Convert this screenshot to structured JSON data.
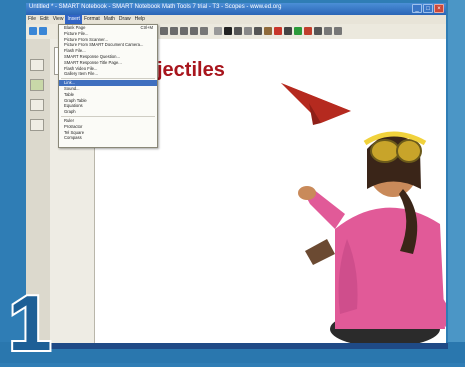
{
  "window": {
    "title": "Untitled * - SMART Notebook - SMART Notebook Math Tools 7 trial - T3 - Scopes - www.ed.org"
  },
  "menubar": [
    {
      "label": "File"
    },
    {
      "label": "Edit"
    },
    {
      "label": "View"
    },
    {
      "label": "Insert",
      "active": true
    },
    {
      "label": "Format"
    },
    {
      "label": "Math"
    },
    {
      "label": "Draw"
    },
    {
      "label": "Help"
    }
  ],
  "insert_menu": {
    "items": [
      {
        "label": "Blank Page",
        "shortcut": "Ctrl+M"
      },
      {
        "label": "Picture File..."
      },
      {
        "label": "Picture From Scanner..."
      },
      {
        "label": "Picture From SMART Document Camera..."
      },
      {
        "label": "Flash File..."
      },
      {
        "label": "SMART Response Question..."
      },
      {
        "label": "SMART Response Title Page..."
      },
      {
        "label": "Flash Video File..."
      },
      {
        "label": "Gallery Item File..."
      },
      {
        "separator": true
      },
      {
        "label": "Link...",
        "highlight": true
      },
      {
        "label": "Sound..."
      },
      {
        "label": "Table"
      },
      {
        "label": "Graph Table"
      },
      {
        "label": "Equations"
      },
      {
        "label": "Graph"
      },
      {
        "separator": true
      },
      {
        "label": "Ruler"
      },
      {
        "label": "Protractor"
      },
      {
        "label": "Tel Square"
      },
      {
        "label": "Compass"
      }
    ]
  },
  "page": {
    "title": "jectiles"
  },
  "badge": {
    "number": "1"
  },
  "colors": {
    "frame_blue": "#2f7db5",
    "title_red": "#a8151d",
    "menu_highlight": "#3f6fbf"
  },
  "icons": {
    "airplane": "paper-airplane-icon",
    "child": "child-photo"
  }
}
